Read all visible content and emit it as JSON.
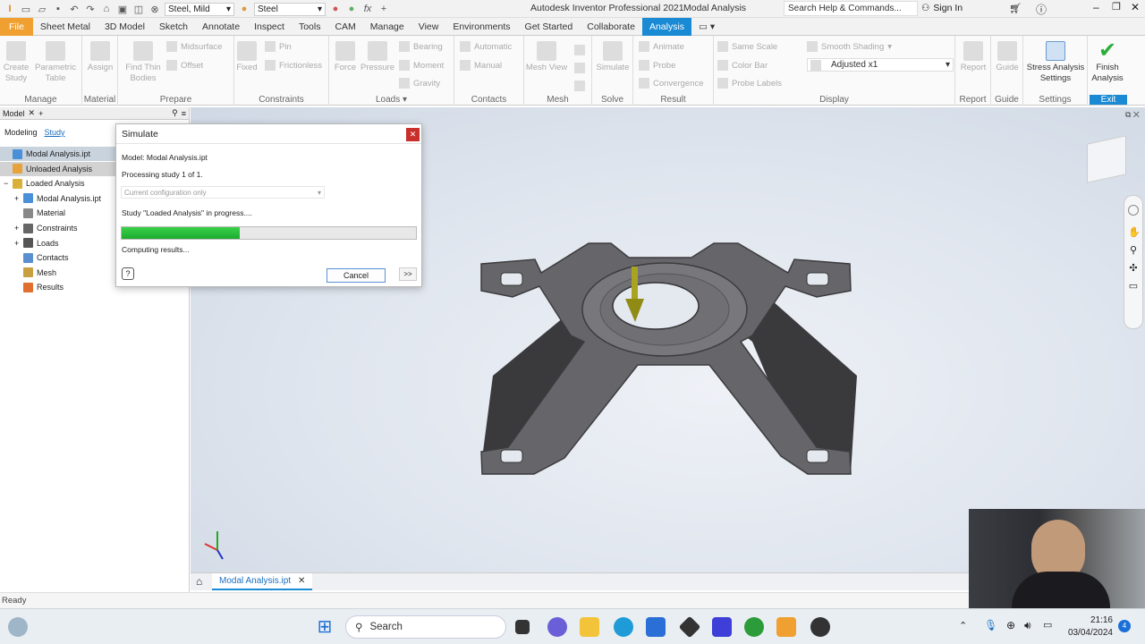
{
  "titlebar": {
    "material": "Steel, Mild",
    "appearance": "Steel",
    "app_title": "Autodesk Inventor Professional 2021",
    "doc_title": "Modal Analysis",
    "search_placeholder": "Search Help & Commands...",
    "sign_in": "Sign In"
  },
  "tabs": [
    "File",
    "Sheet Metal",
    "3D Model",
    "Sketch",
    "Annotate",
    "Inspect",
    "Tools",
    "CAM",
    "Manage",
    "View",
    "Environments",
    "Get Started",
    "Collaborate",
    "Analysis"
  ],
  "ribbon": {
    "manage": {
      "label": "Manage",
      "create_study": "Create Study",
      "parametric_table": "Parametric Table"
    },
    "material": {
      "label": "Material",
      "assign": "Assign"
    },
    "prepare": {
      "label": "Prepare",
      "find_thin_bodies": "Find Thin Bodies",
      "midsurface": "Midsurface",
      "offset": "Offset"
    },
    "constraints": {
      "label": "Constraints",
      "fixed": "Fixed",
      "pin": "Pin",
      "frictionless": "Frictionless"
    },
    "loads": {
      "label": "Loads",
      "force": "Force",
      "pressure": "Pressure",
      "bearing": "Bearing",
      "moment": "Moment",
      "gravity": "Gravity"
    },
    "contacts": {
      "label": "Contacts",
      "automatic": "Automatic",
      "manual": "Manual"
    },
    "mesh": {
      "label": "Mesh",
      "mesh_view": "Mesh View"
    },
    "solve": {
      "label": "Solve",
      "simulate": "Simulate"
    },
    "result": {
      "label": "Result",
      "animate": "Animate",
      "probe": "Probe",
      "convergence": "Convergence"
    },
    "display": {
      "label": "Display",
      "same_scale": "Same Scale",
      "color_bar": "Color Bar",
      "probe_labels": "Probe Labels",
      "smooth_shading": "Smooth Shading",
      "adjusted": "Adjusted x1"
    },
    "report": {
      "label": "Report",
      "report": "Report"
    },
    "guide": {
      "label": "Guide",
      "guide": "Guide"
    },
    "settings": {
      "label": "Settings",
      "stress_settings": "Stress Analysis Settings"
    },
    "exit": {
      "label": "Exit",
      "finish": "Finish Analysis"
    }
  },
  "browser": {
    "tab": "Model",
    "modeling": "Modeling",
    "study": "Study",
    "items": [
      {
        "label": "Modal Analysis.ipt",
        "level": 0,
        "color": "#4a90d9"
      },
      {
        "label": "Unloaded Analysis",
        "level": 0,
        "color": "#e6a23c"
      },
      {
        "label": "Loaded Analysis",
        "level": 0,
        "color": "#d9b13a"
      },
      {
        "label": "Modal Analysis.ipt",
        "level": 1,
        "color": "#4a90d9"
      },
      {
        "label": "Material",
        "level": 1,
        "color": "#888"
      },
      {
        "label": "Constraints",
        "level": 1,
        "color": "#666"
      },
      {
        "label": "Loads",
        "level": 1,
        "color": "#555"
      },
      {
        "label": "Contacts",
        "level": 1,
        "color": "#5a8fd0"
      },
      {
        "label": "Mesh",
        "level": 1,
        "color": "#c9a040"
      },
      {
        "label": "Results",
        "level": 1,
        "color": "#e07030"
      }
    ]
  },
  "dialog": {
    "title": "Simulate",
    "model": "Model: Modal Analysis.ipt",
    "processing": "Processing study 1 of 1.",
    "config": "Current configuration only",
    "study_status": "Study \"Loaded Analysis\" in progress....",
    "progress": 0.4,
    "computing": "Computing results...",
    "cancel": "Cancel",
    "more": ">>"
  },
  "doctab": "Modal Analysis.ipt",
  "status": "Ready",
  "taskbar": {
    "search": "Search",
    "time": "21:16",
    "date": "03/04/2024",
    "badge": "4"
  }
}
